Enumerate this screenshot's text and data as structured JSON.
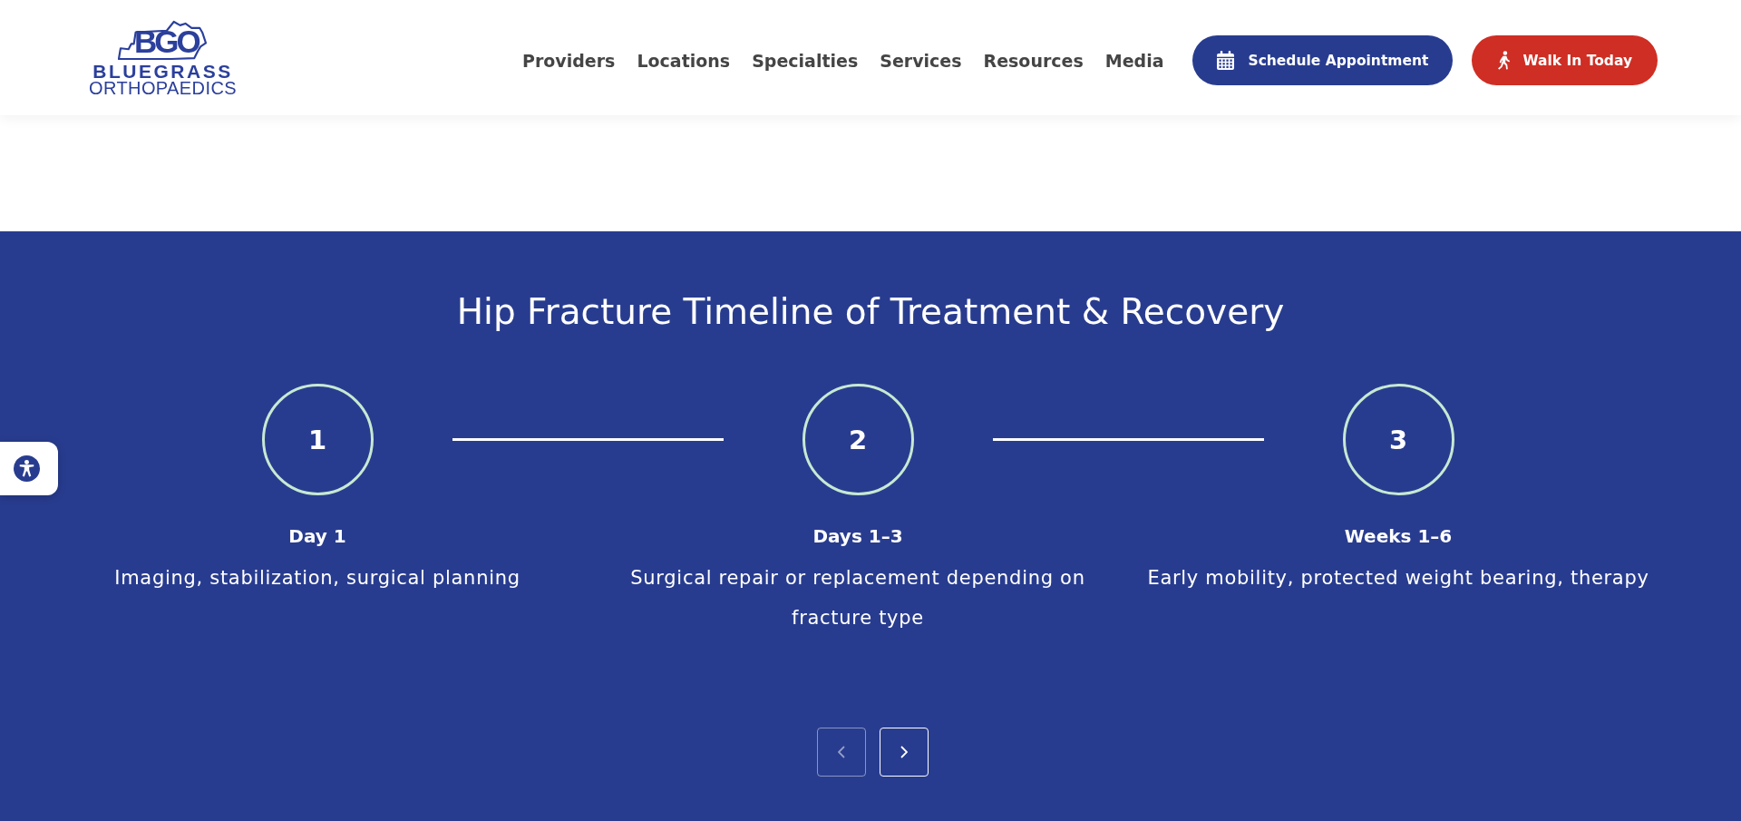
{
  "header": {
    "logo": {
      "mark": "BGO",
      "name": "BLUEGRASS",
      "tagline": "ORTHOPAEDICS"
    },
    "nav": [
      "Providers",
      "Locations",
      "Specialties",
      "Services",
      "Resources",
      "Media"
    ],
    "actions": [
      {
        "kind": "schedule",
        "label": "Schedule Appointment"
      },
      {
        "kind": "walk-in",
        "label": "Walk In Today"
      }
    ]
  },
  "timeline": {
    "title": "Hip Fracture Timeline of Treatment & Recovery",
    "steps": [
      {
        "number": "1",
        "heading": "Day 1",
        "description": "Imaging, stabilization, surgical planning"
      },
      {
        "number": "2",
        "heading": "Days 1–3",
        "description": "Surgical repair or replacement depending on fracture type"
      },
      {
        "number": "3",
        "heading": "Weeks 1–6",
        "description": "Early mobility, protected weight bearing, therapy"
      }
    ],
    "pager": [
      {
        "kind": "previous",
        "disabled": true
      },
      {
        "kind": "next",
        "disabled": false
      }
    ]
  }
}
